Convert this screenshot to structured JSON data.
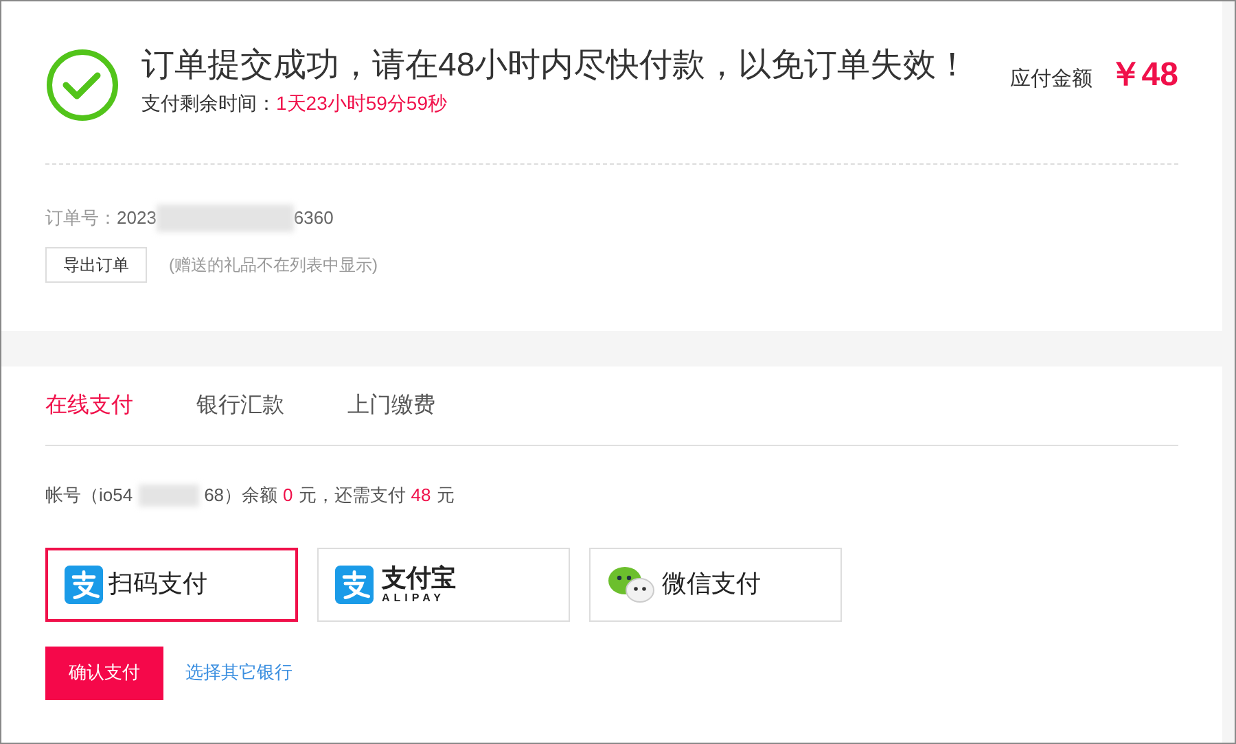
{
  "order": {
    "headline": "订单提交成功，请在48小时内尽快付款，以免订单失效！",
    "countdown_label": "支付剩余时间：",
    "countdown": "1天23小时59分59秒",
    "amount_label": "应付金额",
    "amount": "￥48",
    "number_label": "订单号：",
    "number_start": "2023",
    "number_end": "6360",
    "export_button": "导出订单",
    "note": "(赠送的礼品不在列表中显示)"
  },
  "tabs": [
    {
      "label": "在线支付",
      "selected": true
    },
    {
      "label": "银行汇款",
      "selected": false
    },
    {
      "label": "上门缴费",
      "selected": false
    }
  ],
  "account": {
    "label": "帐号（io54",
    "label_end": "68）余额",
    "balance": "0",
    "unit1": "元，还需支付",
    "due": "48",
    "unit2": "元"
  },
  "methods": [
    {
      "kind": "alipay",
      "label": "扫码支付",
      "selected": true
    },
    {
      "kind": "alipay",
      "label": "支付宝",
      "sublabel": "ALIPAY",
      "selected": false
    },
    {
      "kind": "wechat",
      "label": "微信支付",
      "selected": false
    }
  ],
  "confirm_button": "确认支付",
  "other_bank_link": "选择其它银行"
}
